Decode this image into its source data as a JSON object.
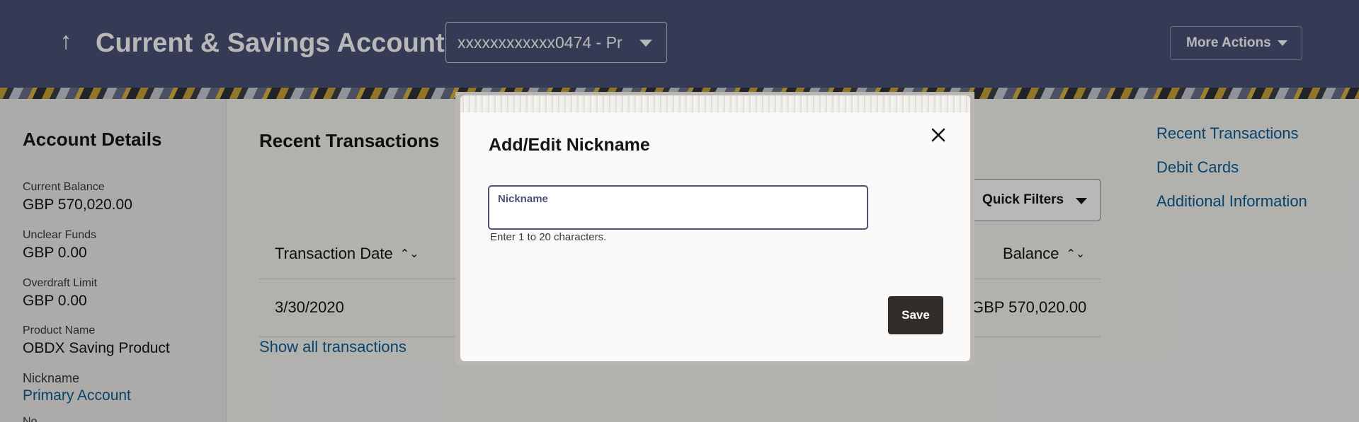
{
  "header": {
    "back_icon": "arrow-up-icon",
    "title": "Current & Savings Account",
    "account_selector": "xxxxxxxxxxxx0474 - Pr",
    "more_actions": "More Actions"
  },
  "account_details": {
    "heading": "Account Details",
    "current_balance_label": "Current Balance",
    "current_balance_value": "GBP 570,020.00",
    "unclear_funds_label": "Unclear Funds",
    "unclear_funds_value": "GBP 0.00",
    "overdraft_limit_label": "Overdraft Limit",
    "overdraft_limit_value": "GBP 0.00",
    "product_name_label": "Product Name",
    "product_name_value": "OBDX Saving Product",
    "nickname_label": "Nickname",
    "nickname_value": "Primary Account",
    "next_label_partial": "No"
  },
  "transactions": {
    "heading": "Recent Transactions",
    "quick_filters": "Quick Filters",
    "columns": {
      "transaction_date": "Transaction Date",
      "balance": "Balance"
    },
    "rows": [
      {
        "transaction_date": "3/30/2020",
        "balance": "GBP 570,020.00"
      }
    ],
    "show_all": "Show all transactions"
  },
  "quick_links": [
    "Recent Transactions",
    "Debit Cards",
    "Additional Information"
  ],
  "modal": {
    "title": "Add/Edit Nickname",
    "close_icon": "close-icon",
    "field_label": "Nickname",
    "field_value": "",
    "field_help": "Enter 1 to 20 characters.",
    "save_label": "Save"
  },
  "colors": {
    "header_bg": "#4a5376",
    "link": "#0e5e94",
    "primary_button": "#312d2a"
  }
}
